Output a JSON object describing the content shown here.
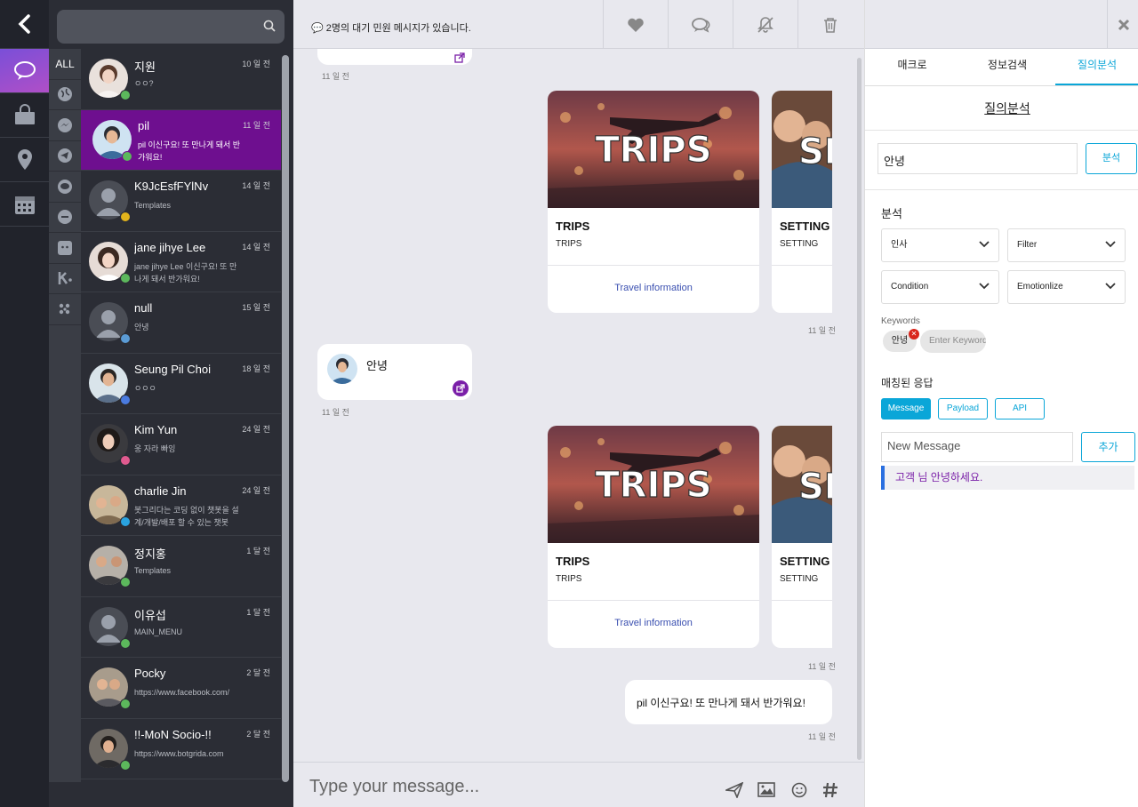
{
  "notice": "💬 2명의 대기 민원 메시지가 있습니다.",
  "rail": {
    "items": [
      "back-icon",
      "chat-icon",
      "shop-icon",
      "location-icon",
      "calendar-icon"
    ]
  },
  "channels": {
    "all_label": "ALL"
  },
  "conversations": [
    {
      "name": "지원",
      "time": "10 일 전",
      "preview": "ㅇㅇ?",
      "badge": "#5cb85c"
    },
    {
      "name": "pil",
      "time": "11 일 전",
      "preview": "pil 이신구요! 또 만나게 돼서 반가워요!",
      "badge": "#5cb85c"
    },
    {
      "name": "K9JcEsfFYlNv",
      "time": "14 일 전",
      "preview": "Templates",
      "badge": "#e2b41c"
    },
    {
      "name": "jane jihye Lee",
      "time": "14 일 전",
      "preview": "jane jihye Lee 이신구요! 또 만나게 돼서 반가워요!",
      "badge": "#5cb85c"
    },
    {
      "name": "null",
      "time": "15 일 전",
      "preview": "안녕",
      "badge": "#5b9bd5"
    },
    {
      "name": "Seung Pil Choi",
      "time": "18 일 전",
      "preview": "ㅇㅇㅇ",
      "badge": "#4a7be0"
    },
    {
      "name": "Kim Yun",
      "time": "24 일 전",
      "preview": "웅 자라 빠잉",
      "badge": "#e05a8f"
    },
    {
      "name": "charlie Jin",
      "time": "24 일 전",
      "preview": "봇그리다는 코딩 없이 챗봇을 설계/개발/배포 할 수 있는 챗봇",
      "badge": "#2aa3e0"
    },
    {
      "name": "정지홍",
      "time": "1 달 전",
      "preview": "Templates",
      "badge": "#5cb85c"
    },
    {
      "name": "이유섭",
      "time": "1 달 전",
      "preview": "MAIN_MENU",
      "badge": "#5cb85c"
    },
    {
      "name": "Pocky",
      "time": "2 달 전",
      "preview": "https://www.facebook.com/",
      "badge": "#5cb85c"
    },
    {
      "name": "!!-MoN Socio-!!",
      "time": "2 달 전",
      "preview": "https://www.botgrida.com",
      "badge": "#5cb85c"
    }
  ],
  "chat": {
    "timestamps": [
      "11 일 전",
      "11 일 전",
      "11 일 전",
      "11 일 전",
      "11 일 전"
    ],
    "incoming_text": "안녕",
    "cards": [
      {
        "title": "TRIPS",
        "subtitle": "TRIPS",
        "button": "Travel information",
        "image_text": "TRIPS"
      },
      {
        "title": "SETTING",
        "subtitle": "SETTING",
        "image_text": "SE"
      }
    ],
    "outgoing_text": "pil 이신구요! 또 만나게 돼서 반가워요!",
    "composer_placeholder": "Type your message..."
  },
  "panel": {
    "tabs": [
      "매크로",
      "정보검색",
      "질의분석"
    ],
    "active_tab": 2,
    "section_title": "질의분석",
    "query_value": "안녕",
    "analyze_button": "분석",
    "analysis_label": "분석",
    "selects": [
      "인사",
      "Filter",
      "Condition",
      "Emotionlize"
    ],
    "keywords_label": "Keywords",
    "keyword_chip": "안녕",
    "keyword_placeholder": "Enter Keyword",
    "matched_label": "매칭된 응답",
    "response_types": [
      "Message",
      "Payload",
      "API"
    ],
    "new_message_placeholder": "New Message",
    "add_button": "추가",
    "response_item": "고객 님 안녕하세요."
  },
  "colors": {
    "accent": "#0aa6d8",
    "selected_row": "#6e0f8f",
    "rail": "#21232b"
  }
}
